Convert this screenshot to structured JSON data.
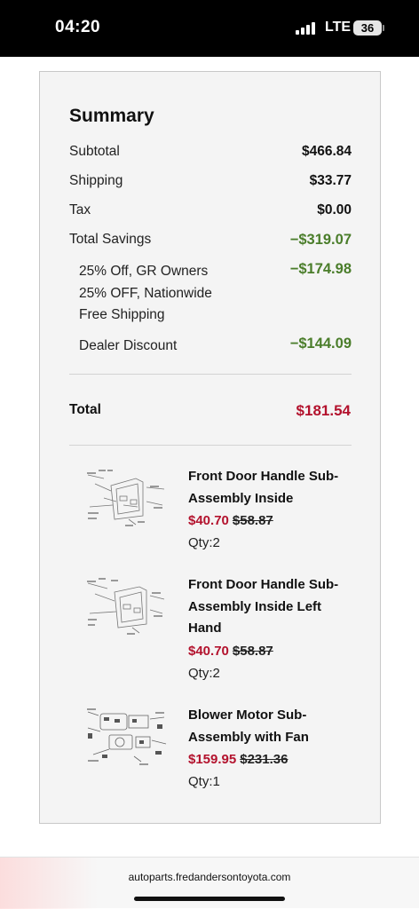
{
  "status_bar": {
    "time": "04:20",
    "network": "LTE",
    "battery": "36"
  },
  "summary": {
    "title": "Summary",
    "subtotal_label": "Subtotal",
    "subtotal_value": "$466.84",
    "shipping_label": "Shipping",
    "shipping_value": "$33.77",
    "tax_label": "Tax",
    "tax_value": "$0.00",
    "savings_label": "Total Savings",
    "savings_value": "−$319.07",
    "discounts": [
      {
        "lines": [
          "25% Off, GR Owners",
          "25% OFF, Nationwide",
          "Free Shipping"
        ],
        "value": "−$174.98"
      },
      {
        "lines": [
          "Dealer Discount"
        ],
        "value": "−$144.09"
      }
    ],
    "total_label": "Total",
    "total_value": "$181.54"
  },
  "items": [
    {
      "name_lines": [
        "Front Door Handle Sub-",
        "Assembly Inside"
      ],
      "price": "$40.70",
      "old_price": "$58.87",
      "qty": "Qty:2",
      "icon": "parts-diagram-icon"
    },
    {
      "name_lines": [
        "Front Door Handle Sub-",
        "Assembly Inside Left",
        "Hand"
      ],
      "price": "$40.70",
      "old_price": "$58.87",
      "qty": "Qty:2",
      "icon": "parts-diagram-icon"
    },
    {
      "name_lines": [
        "Blower Motor Sub-",
        "Assembly with Fan"
      ],
      "price": "$159.95",
      "old_price": "$231.36",
      "qty": "Qty:1",
      "icon": "parts-diagram-icon"
    }
  ],
  "browser": {
    "url": "autoparts.fredandersontoyota.com"
  },
  "colors": {
    "savings_green": "#4a7d2a",
    "price_red": "#b3122d"
  }
}
